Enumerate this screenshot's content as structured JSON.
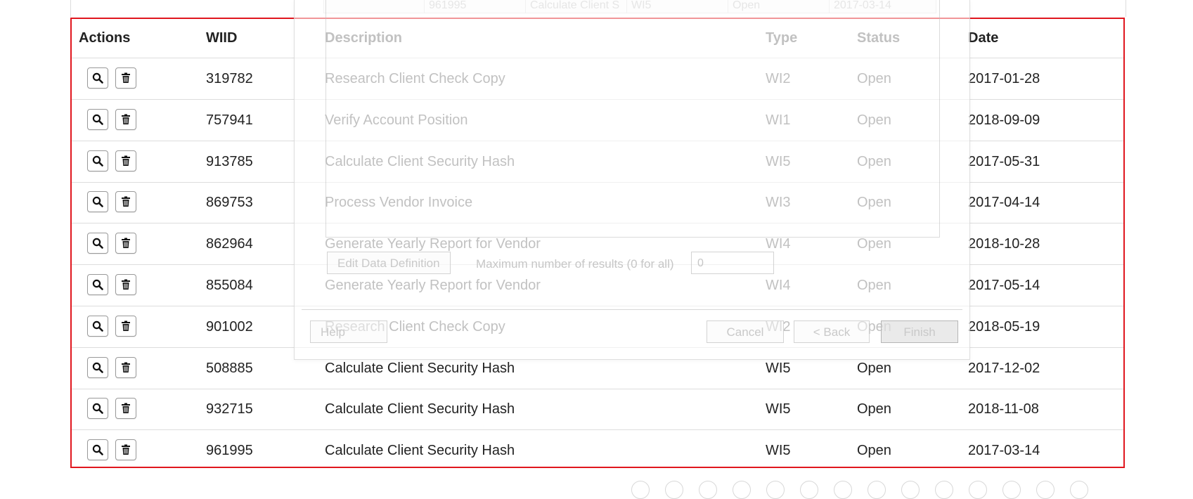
{
  "top_partial_row": {
    "wiid": "961995",
    "description": "Calculate Client S",
    "type": "WI5",
    "status": "Open",
    "date": "2017-03-14"
  },
  "table": {
    "headers": {
      "actions": "Actions",
      "wiid": "WIID",
      "description": "Description",
      "type": "Type",
      "status": "Status",
      "date": "Date"
    },
    "rows": [
      {
        "wiid": "319782",
        "description": "Research Client Check Copy",
        "type": "WI2",
        "status": "Open",
        "date": "2017-01-28"
      },
      {
        "wiid": "757941",
        "description": "Verify Account Position",
        "type": "WI1",
        "status": "Open",
        "date": "2018-09-09"
      },
      {
        "wiid": "913785",
        "description": "Calculate Client Security Hash",
        "type": "WI5",
        "status": "Open",
        "date": "2017-05-31"
      },
      {
        "wiid": "869753",
        "description": "Process Vendor Invoice",
        "type": "WI3",
        "status": "Open",
        "date": "2017-04-14"
      },
      {
        "wiid": "862964",
        "description": "Generate Yearly Report for Vendor",
        "type": "WI4",
        "status": "Open",
        "date": "2018-10-28"
      },
      {
        "wiid": "855084",
        "description": "Generate Yearly Report for Vendor",
        "type": "WI4",
        "status": "Open",
        "date": "2017-05-14"
      },
      {
        "wiid": "901002",
        "description": "Research Client Check Copy",
        "type": "WI2",
        "status": "Open",
        "date": "2018-05-19"
      },
      {
        "wiid": "508885",
        "description": "Calculate Client Security Hash",
        "type": "WI5",
        "status": "Open",
        "date": "2017-12-02"
      },
      {
        "wiid": "932715",
        "description": "Calculate Client Security Hash",
        "type": "WI5",
        "status": "Open",
        "date": "2018-11-08"
      },
      {
        "wiid": "961995",
        "description": "Calculate Client Security Hash",
        "type": "WI5",
        "status": "Open",
        "date": "2017-03-14"
      }
    ]
  },
  "dialog": {
    "edit_data_definition": "Edit Data Definition",
    "max_results_label": "Maximum number of results (0 for all)",
    "max_results_value": "0",
    "help": "Help",
    "cancel": "Cancel",
    "back": "< Back",
    "finish": "Finish"
  },
  "colors": {
    "table_border": "#e0161e",
    "row_divider": "#dddddd"
  },
  "icons": {
    "view": "search-icon",
    "delete": "trash-icon"
  }
}
